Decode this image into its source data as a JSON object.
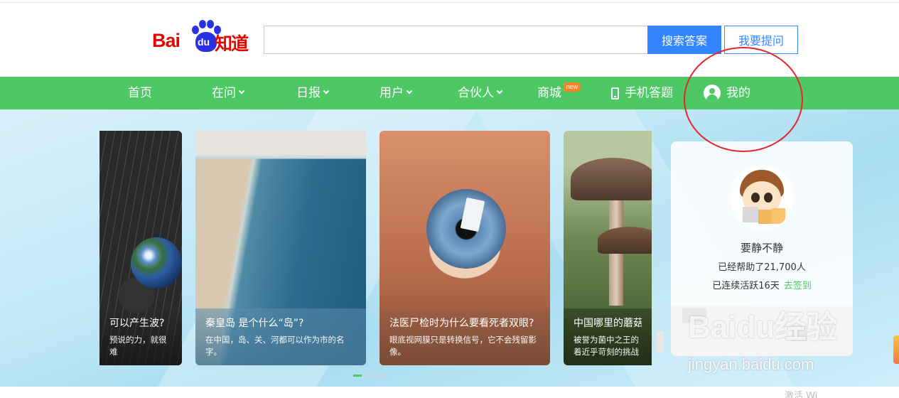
{
  "header": {
    "logo": {
      "bai": "Bai",
      "du": "du",
      "zhidao": "知道"
    },
    "search": {
      "value": "",
      "placeholder": ""
    },
    "search_button": "搜索答案",
    "ask_button": "我要提问"
  },
  "nav": {
    "items": [
      {
        "label": "首页"
      },
      {
        "label": "在问"
      },
      {
        "label": "日报"
      },
      {
        "label": "用户"
      },
      {
        "label": "合伙人"
      },
      {
        "label": "商城",
        "badge": "new"
      },
      {
        "label": "手机答题"
      },
      {
        "label": "我的"
      }
    ]
  },
  "carousel": {
    "cards": [
      {
        "title": "​可以产生波?",
        "desc": "预说的力，就很难"
      },
      {
        "title": "秦皇岛 是个什么“岛”?",
        "desc": "在中国，岛、关、河都可以作为市的名字。"
      },
      {
        "title": "法医尸检时为什么要看死者双眼?",
        "desc": "眼底视网膜只是转换信号，它不会残留影像。"
      },
      {
        "title": "中国哪里的蘑菇最",
        "desc": "被誉为菌中之王的 着近乎苛刻的挑战"
      }
    ],
    "active_index": 0,
    "page_count": 3
  },
  "user_panel": {
    "name": "要静不静",
    "helped": "已经帮助了21,700人",
    "streak": "已连续活跃16天",
    "signin_link": "去签到"
  },
  "watermark": {
    "text": "Baidu经验",
    "url": "jingyan.baidu.com"
  },
  "bottom_text": "激活 Wi",
  "colors": {
    "nav_green": "#4ec865",
    "search_blue": "#3385ff",
    "logo_red": "#e10601",
    "annotation_red": "#e6262d"
  }
}
